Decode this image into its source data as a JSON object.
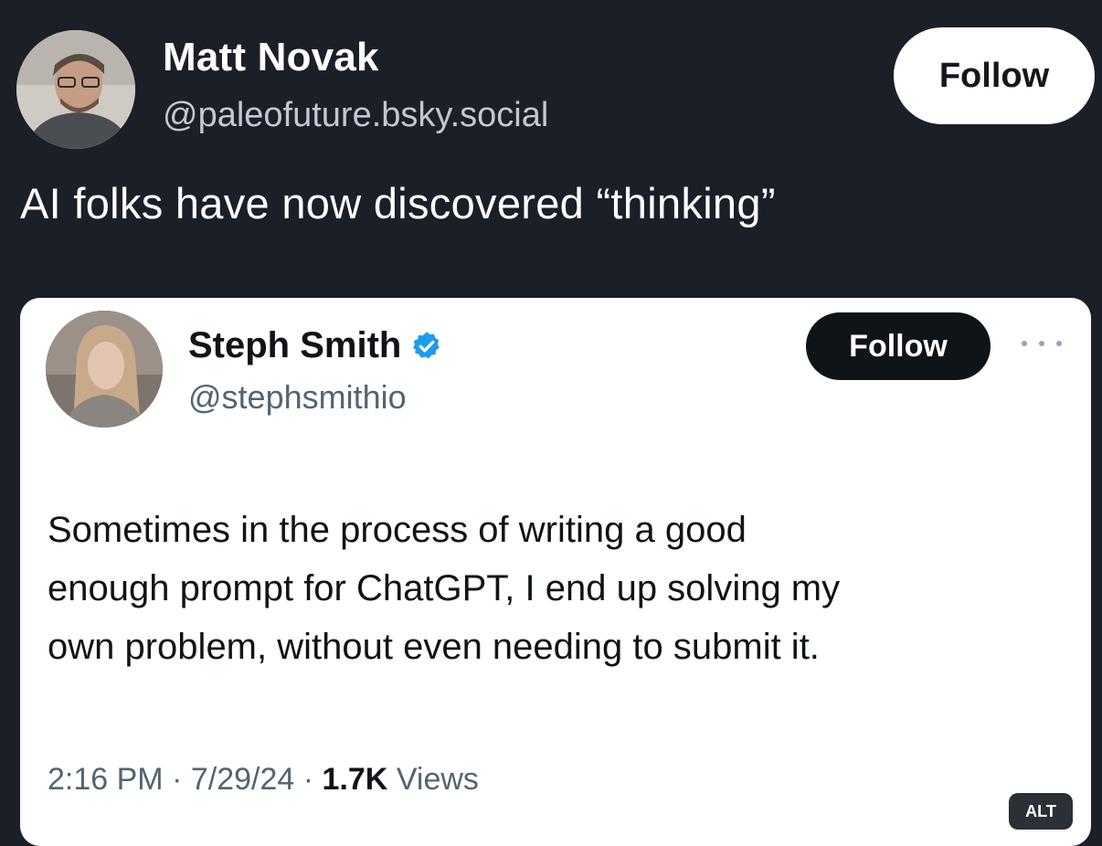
{
  "outer_post": {
    "author_name": "Matt Novak",
    "author_handle": "@paleofuture.bsky.social",
    "follow_label": "Follow",
    "text": "AI folks have now discovered “thinking”"
  },
  "quoted_tweet": {
    "author_name": "Steph Smith",
    "author_handle": "@stephsmithio",
    "verified": true,
    "follow_label": "Follow",
    "text_lines": [
      "Sometimes in the process of writing a good",
      "enough prompt for ChatGPT, I end up solving my",
      "own problem, without even needing to submit it."
    ],
    "time": "2:16 PM",
    "date": "7/29/24",
    "views_count": "1.7K",
    "views_label": "Views",
    "alt_badge": "ALT"
  },
  "colors": {
    "background": "#1b1f28",
    "verified_blue": "#1d9bf0",
    "secondary_text": "#536471"
  },
  "icons": {
    "verified": "verified-badge-icon",
    "more": "more-options-icon"
  }
}
